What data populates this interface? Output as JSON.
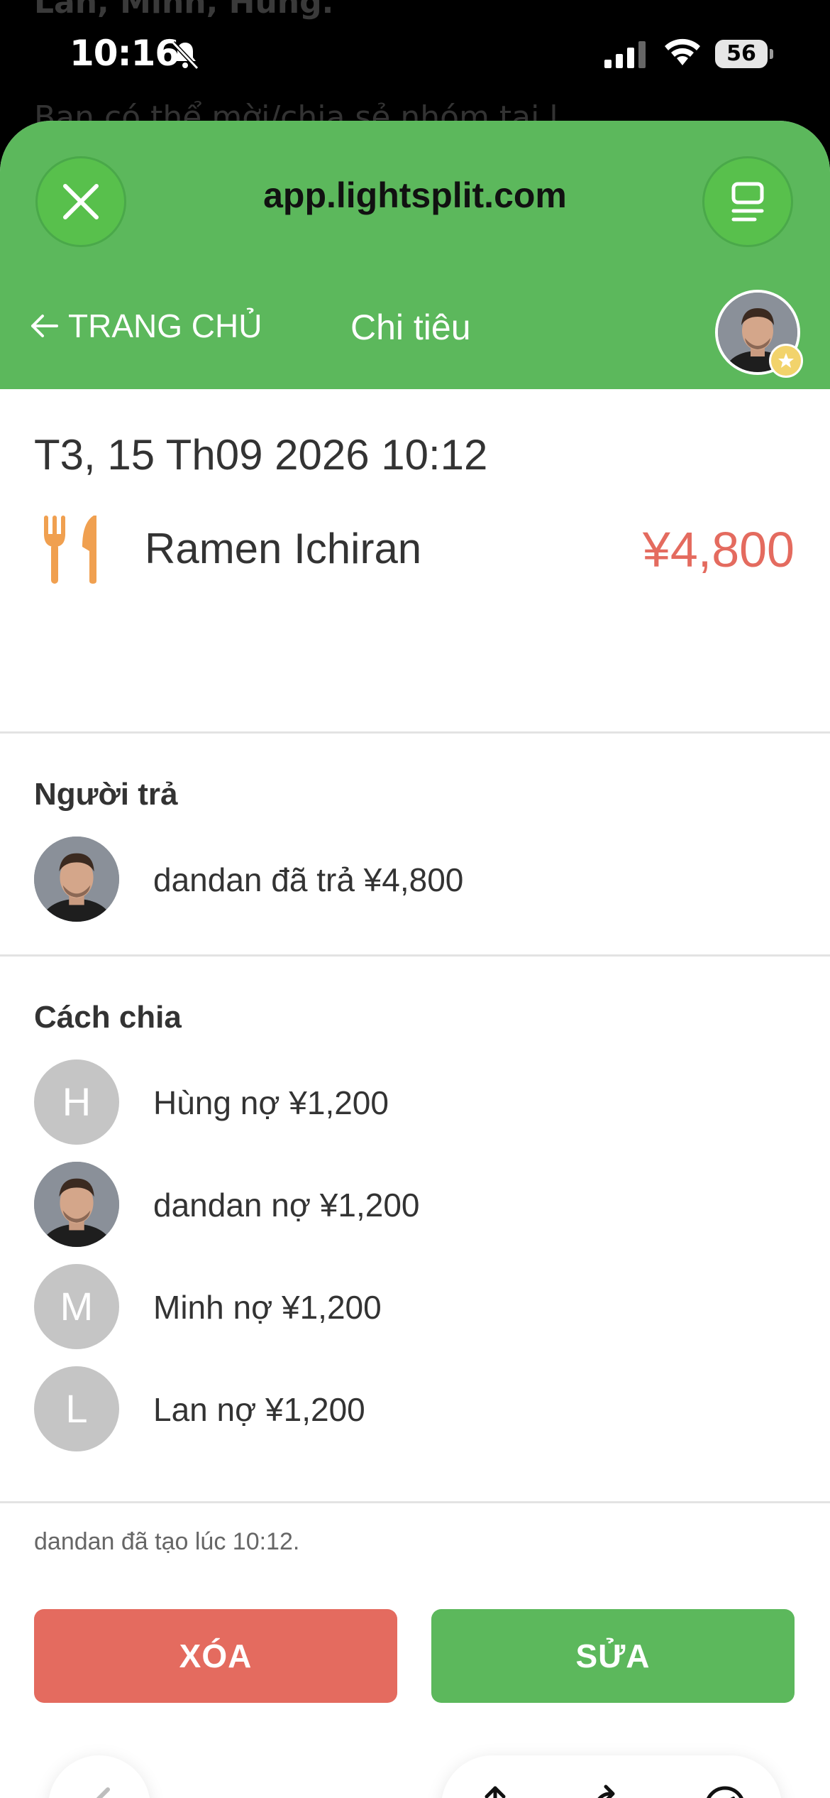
{
  "status_bar": {
    "time": "10:16",
    "battery": "56",
    "background_text_top": "Lan, Minh, Hùng.",
    "background_text_2": "Bạn có thể mời/chia sẻ nhóm tại l"
  },
  "browser": {
    "url": "app.lightsplit.com"
  },
  "header": {
    "back_label": "TRANG CHỦ",
    "title": "Chi tiêu"
  },
  "expense": {
    "date": "T3, 15 Th09 2026 10:12",
    "name": "Ramen Ichiran",
    "amount": "¥4,800",
    "category_icon": "fork-knife-icon"
  },
  "payer_section": {
    "title": "Người trả",
    "items": [
      {
        "text": "dandan đã trả ¥4,800",
        "avatar": "photo"
      }
    ]
  },
  "split_section": {
    "title": "Cách chia",
    "items": [
      {
        "initial": "H",
        "text": "Hùng nợ ¥1,200"
      },
      {
        "initial": "",
        "text": "dandan nợ ¥1,200"
      },
      {
        "initial": "M",
        "text": "Minh nợ ¥1,200"
      },
      {
        "initial": "L",
        "text": "Lan nợ ¥1,200"
      }
    ]
  },
  "footer": {
    "created_text": "dandan đã tạo lúc 10:12.",
    "delete_label": "XÓA",
    "edit_label": "SỬA"
  },
  "colors": {
    "brand_green": "#5cb85c",
    "danger_red": "#e46b5f",
    "avatar_grey": "#c5c5c5"
  }
}
